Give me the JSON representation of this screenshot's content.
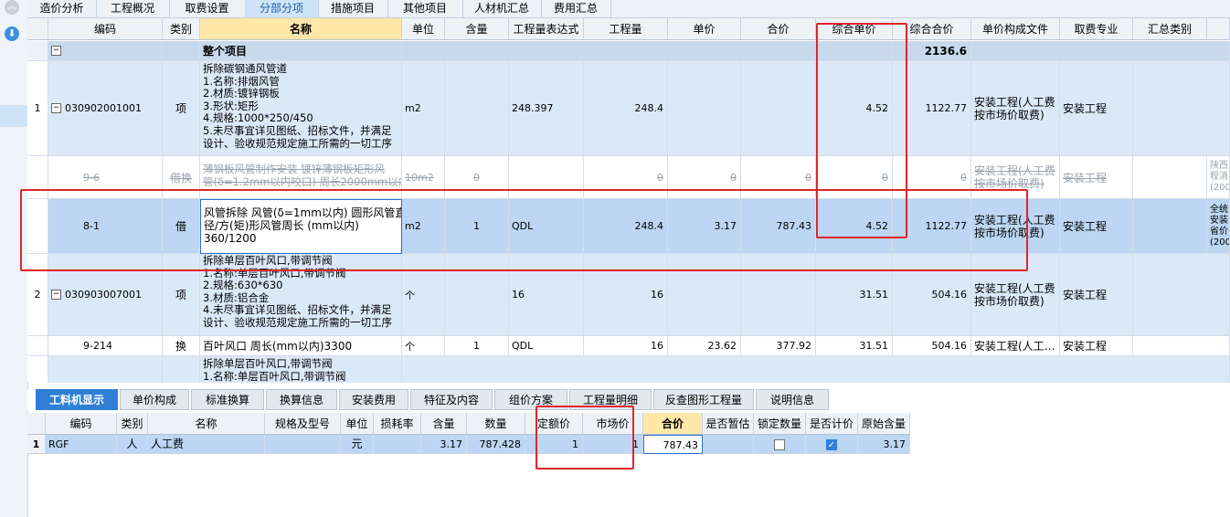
{
  "top_tabs": [
    "造价分析",
    "工程概况",
    "取费设置",
    "分部分项",
    "措施项目",
    "其他项目",
    "人材机汇总",
    "费用汇总"
  ],
  "columns": [
    "编码",
    "类别",
    "名称",
    "单位",
    "含量",
    "工程量表达式",
    "工程量",
    "单价",
    "合价",
    "综合单价",
    "综合合价",
    "单价构成文件",
    "取费专业",
    "汇总类别"
  ],
  "summary": {
    "label": "整个项目",
    "total": "2136.6",
    "toggle": "−"
  },
  "rows": {
    "r1": {
      "num": "1",
      "code": "030902001001",
      "type": "项",
      "name": "拆除碳钢通风管道\n1.名称:排烟风管\n2.材质:镀锌钢板\n3.形状:矩形\n4.规格:1000*250/450\n5.未尽事宜详见图纸、招标文件，并满足\n设计、验收规范规定施工所需的一切工序",
      "unit": "m2",
      "expr": "248.397",
      "qty": "248.4",
      "unit_price": "",
      "total": "",
      "comp_price": "4.52",
      "comp_total": "1122.77",
      "file": "安装工程(人工费\n按市场价取费)",
      "major": "安装工程"
    },
    "r2": {
      "code": "9-6",
      "type": "借换",
      "name": "薄钢板风管制作安装 镀锌薄钢板矩形风\n管(δ=1.2mm以内咬口) 周长2000mm以内",
      "unit": "10m2",
      "content": "0",
      "qty": "0",
      "unit_price": "0",
      "total": "0",
      "comp_price": "0",
      "comp_total": "0",
      "file": "安装工程(人工费\n按市场价取费)",
      "major": "安装工程",
      "extra": "陕西\n程消\n(200"
    },
    "r3": {
      "code": "8-1",
      "type": "借",
      "name": "风管拆除 风管(δ=1mm以内) 圆形风管直\n径/方(矩)形风管周长 (mm以内)\n360/1200",
      "unit": "m2",
      "content": "1",
      "expr": "QDL",
      "qty": "248.4",
      "unit_price": "3.17",
      "total": "787.43",
      "comp_price": "4.52",
      "comp_total": "1122.77",
      "file": "安装工程(人工费\n按市场价取费)",
      "major": "安装工程",
      "extra": "全统\n安装\n省价\n(200"
    },
    "r4": {
      "num": "2",
      "code": "030903007001",
      "type": "项",
      "name": "拆除单层百叶风口,带调节阀\n1.名称:单层百叶风口,带调节阀\n2.规格:630*630\n3.材质:铝合金\n4.未尽事宜详见图纸、招标文件，并满足\n设计、验收规范规定施工所需的一切工序",
      "unit": "个",
      "expr": "16",
      "qty": "16",
      "comp_price": "31.51",
      "comp_total": "504.16",
      "file": "安装工程(人工费\n按市场价取费)",
      "major": "安装工程"
    },
    "r5": {
      "code": "9-214",
      "type": "换",
      "name": "百叶风口 周长(mm以内)3300",
      "unit": "个",
      "content": "1",
      "expr": "QDL",
      "qty": "16",
      "unit_price": "23.62",
      "total": "377.92",
      "comp_price": "31.51",
      "comp_total": "504.16",
      "file": "安装工程(人工…",
      "major": "安装工程"
    },
    "r6": {
      "name": "拆除单层百叶风口,带调节阀\n1.名称:单层百叶风口,带调节阀"
    }
  },
  "bottom_tabs": [
    "工料机显示",
    "单价构成",
    "标准换算",
    "换算信息",
    "安装费用",
    "特征及内容",
    "组价方案",
    "工程量明细",
    "反查图形工程量",
    "说明信息"
  ],
  "bottom_columns": [
    "编码",
    "类别",
    "名称",
    "规格及型号",
    "单位",
    "损耗率",
    "含量",
    "数量",
    "定额价",
    "市场价",
    "合价",
    "是否暂估",
    "锁定数量",
    "是否计价",
    "原始含量"
  ],
  "bottom_row": {
    "num": "1",
    "code": "RGF",
    "type": "人",
    "name": "人工费",
    "unit": "元",
    "content": "3.17",
    "qty": "787.428",
    "quota_price": "1",
    "market_price": "1",
    "total": "787.43",
    "orig": "3.17"
  },
  "icons": {
    "collapse": "chevron-up-icon",
    "download": "download-icon"
  },
  "colors": {
    "active_tab": "#2f7fd6",
    "header_bg": "#eef2f7",
    "name_header_bg": "#ffe7a8",
    "row_blue": "#dbe8f7",
    "selected_row": "#bcd6f3",
    "annotation": "#e0262a"
  }
}
